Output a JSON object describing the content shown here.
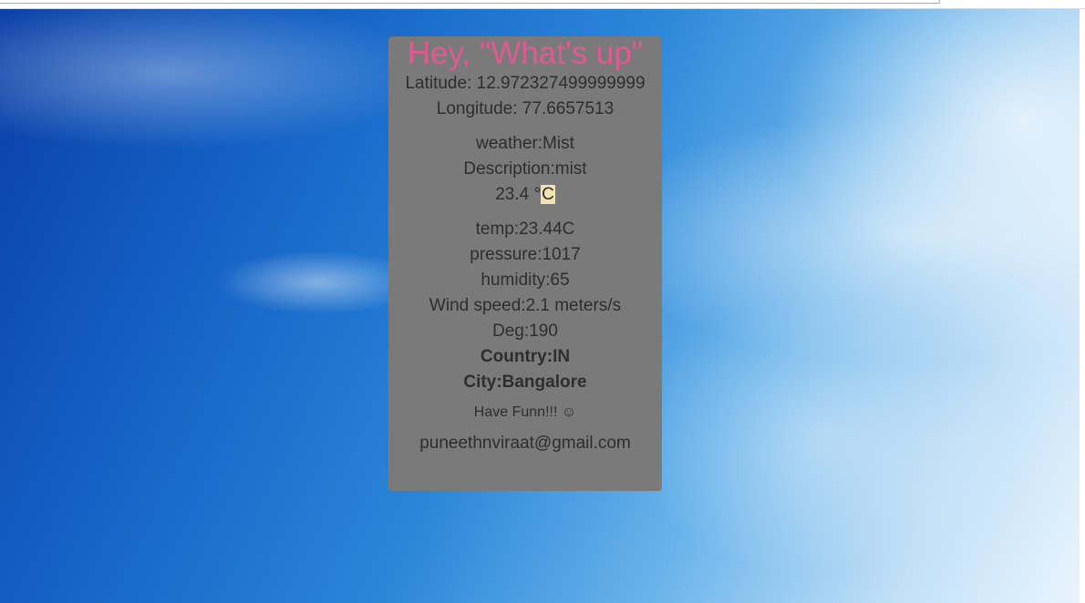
{
  "card": {
    "title": "Hey, \"What's up\"",
    "latitude": "Latitude: 12.972327499999999",
    "longitude": "Longitude: 77.6657513",
    "weather": "weather:Mist",
    "description": "Description:mist",
    "temp_value": "23.4 °",
    "temp_unit": "C",
    "temp": "temp:23.44C",
    "pressure": "pressure:1017",
    "humidity": "humidity:65",
    "wind_speed": "Wind speed:2.1 meters/s",
    "deg": "Deg:190",
    "country": "Country:IN",
    "city": "City:Bangalore",
    "fun": "Have Funn!!! ☺",
    "email": "puneethnviraat@gmail.com"
  },
  "colors": {
    "title": "#e05a92",
    "card_bg": "#7a7a7a",
    "text": "#2e2e2e"
  }
}
